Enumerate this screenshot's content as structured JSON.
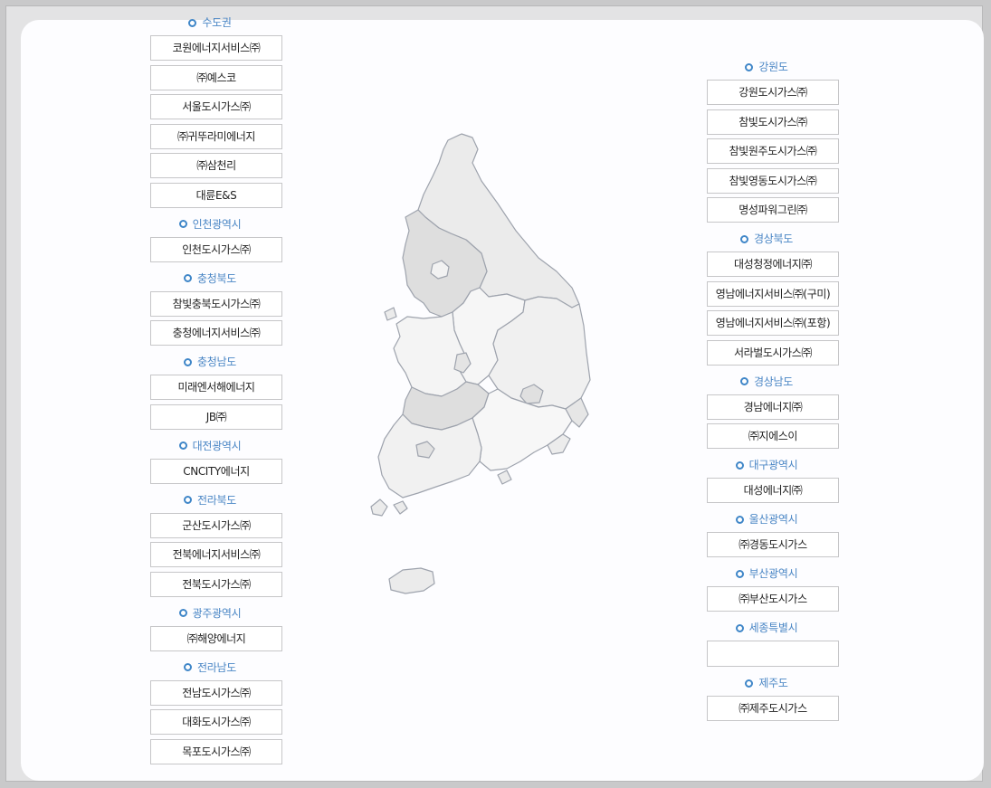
{
  "left_regions": [
    {
      "name": "수도권",
      "companies": [
        "코원에너지서비스㈜",
        "㈜예스코",
        "서울도시가스㈜",
        "㈜귀뚜라미에너지",
        "㈜삼천리",
        "대륜E&S"
      ]
    },
    {
      "name": "인천광역시",
      "companies": [
        "인천도시가스㈜"
      ]
    },
    {
      "name": "충청북도",
      "companies": [
        "참빛충북도시가스㈜",
        "충청에너지서비스㈜"
      ]
    },
    {
      "name": "충청남도",
      "companies": [
        "미래엔서해에너지",
        "JB㈜"
      ]
    },
    {
      "name": "대전광역시",
      "companies": [
        "CNCITY에너지"
      ]
    },
    {
      "name": "전라북도",
      "companies": [
        "군산도시가스㈜",
        "전북에너지서비스㈜",
        "전북도시가스㈜"
      ]
    },
    {
      "name": "광주광역시",
      "companies": [
        "㈜해양에너지"
      ]
    },
    {
      "name": "전라남도",
      "companies": [
        "전남도시가스㈜",
        "대화도시가스㈜",
        "목포도시가스㈜"
      ]
    }
  ],
  "right_regions": [
    {
      "name": "강원도",
      "companies": [
        "강원도시가스㈜",
        "참빛도시가스㈜",
        "참빛원주도시가스㈜",
        "참빛영동도시가스㈜",
        "명성파워그린㈜"
      ]
    },
    {
      "name": "경상북도",
      "companies": [
        "대성청정에너지㈜",
        "영남에너지서비스㈜(구미)",
        "영남에너지서비스㈜(포항)",
        "서라벌도시가스㈜"
      ]
    },
    {
      "name": "경상남도",
      "companies": [
        "경남에너지㈜",
        "㈜지에스이"
      ]
    },
    {
      "name": "대구광역시",
      "companies": [
        "대성에너지㈜"
      ]
    },
    {
      "name": "울산광역시",
      "companies": [
        "㈜경동도시가스"
      ]
    },
    {
      "name": "부산광역시",
      "companies": [
        "㈜부산도시가스"
      ]
    },
    {
      "name": "세종특별시",
      "companies": [
        ""
      ]
    },
    {
      "name": "제주도",
      "companies": [
        "㈜제주도시가스"
      ]
    }
  ],
  "colors": {
    "accent": "#4a86c5",
    "border": "#c6c6c8",
    "map_fill": "#ebebeb",
    "map_stroke": "#9ea3ad"
  },
  "icons": {
    "region_bullet": "ring-bullet-icon"
  }
}
